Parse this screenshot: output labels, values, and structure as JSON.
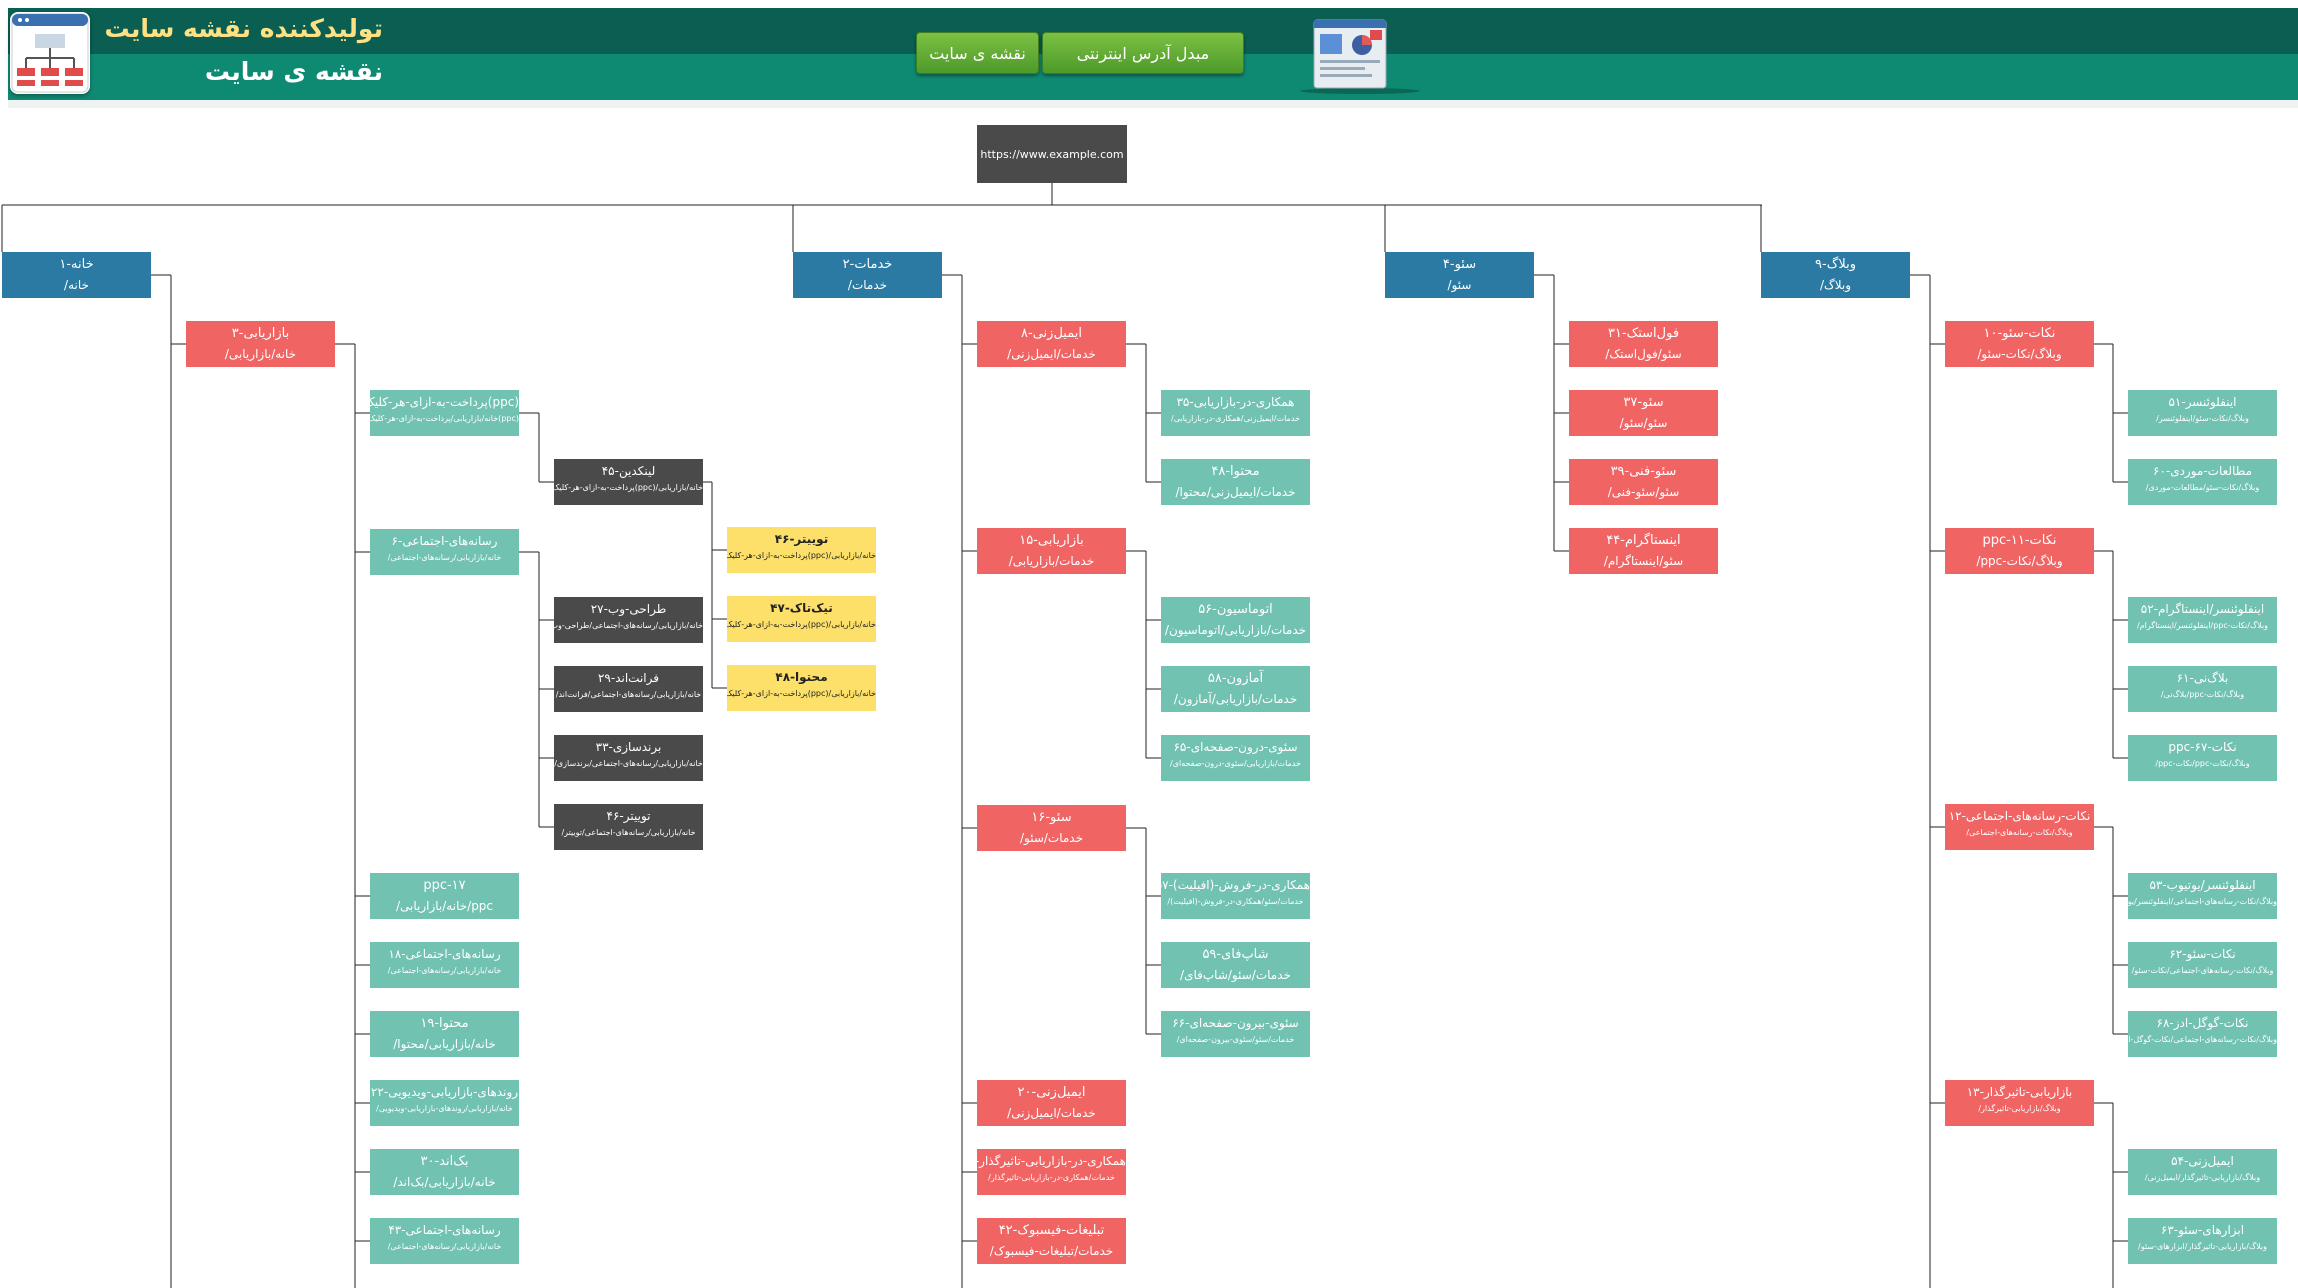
{
  "header": {
    "title": "تولیدکننده نقشه سایت",
    "subtitle": "نقشه ی سایت",
    "buttons": [
      {
        "label": "مبدل آدرس اینترنتی"
      },
      {
        "label": "نقشه ی سایت"
      }
    ]
  },
  "colors": {
    "level1": "#2a7aa3",
    "level2": "#f06464",
    "level3": "#72c2b1",
    "level4": "#4a4a4a",
    "level5": "#fde06a"
  },
  "root": {
    "url": "https://www.example.com"
  },
  "nodes": [
    {
      "id": "home",
      "color": "blue",
      "t1": "خانه-۱",
      "t2": "خانه/"
    },
    {
      "id": "services",
      "color": "blue",
      "t1": "خدمات-۲",
      "t2": "خدمات/"
    },
    {
      "id": "seo",
      "color": "blue",
      "t1": "سئو-۴",
      "t2": "سئو/"
    },
    {
      "id": "blog",
      "color": "blue",
      "t1": "وبلاگ-۹",
      "t2": "وبلاگ/"
    },
    {
      "id": "h-marketing",
      "color": "red",
      "t1": "بازاریابی-۳",
      "t2": "خانه/بازاریابی/"
    },
    {
      "id": "h-ppc5",
      "color": "teal",
      "sm": true,
      "t1": "(ppc)پرداخت-به-ازای-هر-کلیک-۵",
      "t2": "(ppc)خانه/بازاریابی/پرداخت-به-ازای-هر-کلیک/"
    },
    {
      "id": "h-social6",
      "color": "teal",
      "sm": true,
      "t1": "رسانه‌های-اجتماعی-۶",
      "t2": "خانه/بازاریابی/رسانه‌های-اجتماعی/"
    },
    {
      "id": "h-ppc17",
      "color": "teal",
      "t1": "ppc-۱۷",
      "t2": "ppc/خانه/بازاریابی/"
    },
    {
      "id": "h-social18",
      "color": "teal",
      "sm": true,
      "t1": "رسانه‌های-اجتماعی-۱۸",
      "t2": "خانه/بازاریابی/رسانه‌های-اجتماعی/"
    },
    {
      "id": "h-content19",
      "color": "teal",
      "t1": "محتوا-۱۹",
      "t2": "خانه/بازاریابی/محتوا/"
    },
    {
      "id": "h-video22",
      "color": "teal",
      "sm": true,
      "t1": "روندهای-بازاریابی-ویدیویی-۲۲",
      "t2": "خانه/بازاریابی/روندهای-بازاریابی-ویدیویی/"
    },
    {
      "id": "h-backend30",
      "color": "teal",
      "t1": "بک‌اند-۳۰",
      "t2": "خانه/بازاریابی/بک‌اند/"
    },
    {
      "id": "h-social43",
      "color": "teal",
      "sm": true,
      "t1": "رسانه‌های-اجتماعی-۴۳",
      "t2": "خانه/بازاریابی/رسانه‌های-اجتماعی/"
    },
    {
      "id": "h-linkedin45",
      "color": "dark",
      "sm": true,
      "t1": "لینکدین-۴۵",
      "t2": "خانه/بازاریابی/(ppc)پرداخت-به-ازای-هر-کلیک/"
    },
    {
      "id": "h-webdesign27",
      "color": "dark",
      "sm": true,
      "t1": "طراحی-وب-۲۷",
      "t2": "خانه/بازاریابی/رسانه‌های-اجتماعی/طراحی-وب/"
    },
    {
      "id": "h-frontend29",
      "color": "dark",
      "sm": true,
      "t1": "فرانت‌اند-۲۹",
      "t2": "خانه/بازاریابی/رسانه‌های-اجتماعی/فرانت‌اند/"
    },
    {
      "id": "h-branding33",
      "color": "dark",
      "sm": true,
      "t1": "برندسازی-۳۳",
      "t2": "خانه/بازاریابی/رسانه‌های-اجتماعی/برندسازی/"
    },
    {
      "id": "h-twitter46b",
      "color": "dark",
      "sm": true,
      "t1": "توییتر-۴۶",
      "t2": "خانه/بازاریابی/رسانه‌های-اجتماعی/توییتر/"
    },
    {
      "id": "h-twitter46",
      "color": "yellow",
      "sm": true,
      "t1": "توییتر-۴۶",
      "t2": "خانه/بازاریابی/(ppc)پرداخت-به-ازای-هر-کلیک/"
    },
    {
      "id": "h-tiktok47",
      "color": "yellow",
      "sm": true,
      "t1": "تیک‌تاک-۴۷",
      "t2": "خانه/بازاریابی/(ppc)پرداخت-به-ازای-هر-کلیک/تیک‌تاک/"
    },
    {
      "id": "h-content48",
      "color": "yellow",
      "sm": true,
      "t1": "محتوا-۴۸",
      "t2": "خانه/بازاریابی/(ppc)پرداخت-به-ازای-هر-کلیک/"
    },
    {
      "id": "s-email8",
      "color": "red",
      "t1": "ایمیل‌زنی-۸",
      "t2": "خدمات/ایمیل‌زنی/"
    },
    {
      "id": "s-marketing15",
      "color": "red",
      "t1": "بازاریابی-۱۵",
      "t2": "خدمات/بازاریابی/"
    },
    {
      "id": "s-seo16",
      "color": "red",
      "t1": "سئو-۱۶",
      "t2": "خدمات/سئو/"
    },
    {
      "id": "s-email20",
      "color": "red",
      "t1": "ایمیل‌زنی-۲۰",
      "t2": "خدمات/ایمیل‌زنی/"
    },
    {
      "id": "s-affiliate21",
      "color": "red",
      "sm": true,
      "t1": "همکاری-در-بازاریابی-تاثیرگذار-۲۱",
      "t2": "خدمات/همکاری-در-بازاریابی-تاثیرگذار/"
    },
    {
      "id": "s-fbads42",
      "color": "red",
      "t1": "تبلیغات-فیسبوک-۴۲",
      "t2": "خدمات/تبلیغات-فیسبوک/"
    },
    {
      "id": "s-affil35",
      "color": "teal",
      "sm": true,
      "t1": "همکاری-در-بازاریابی-۳۵",
      "t2": "خدمات/ایمیل‌زنی/همکاری-در-بازاریابی/"
    },
    {
      "id": "s-content48",
      "color": "teal",
      "t1": "محتوا-۴۸",
      "t2": "خدمات/ایمیل‌زنی/محتوا/"
    },
    {
      "id": "s-auto56",
      "color": "teal",
      "t1": "اتوماسیون-۵۶",
      "t2": "خدمات/بازاریابی/اتوماسیون/"
    },
    {
      "id": "s-amazon58",
      "color": "teal",
      "t1": "آمازون-۵۸",
      "t2": "خدمات/بازاریابی/آمازون/"
    },
    {
      "id": "s-onpage65",
      "color": "teal",
      "sm": true,
      "t1": "سئوی-درون-صفحه‌ای-۶۵",
      "t2": "خدمات/بازاریابی/سئوی-درون-صفحه‌ای/"
    },
    {
      "id": "s-affiliate57",
      "color": "teal",
      "sm": true,
      "t1": "همکاری-در-فروش-(افیلیت)-۵۷",
      "t2": "خدمات/سئو/همکاری-در-فروش-(افیلیت)/"
    },
    {
      "id": "s-shopify59",
      "color": "teal",
      "t1": "شاپ‌فای-۵۹",
      "t2": "خدمات/سئو/شاپ‌فای/"
    },
    {
      "id": "s-offpage66",
      "color": "teal",
      "sm": true,
      "t1": "سئوی-بیرون-صفحه‌ای-۶۶",
      "t2": "خدمات/سئو/سئوی-بیرون-صفحه‌ای/"
    },
    {
      "id": "o-fullstack31",
      "color": "red",
      "t1": "فول‌استک-۳۱",
      "t2": "سئو/فول‌استک/"
    },
    {
      "id": "o-seo37",
      "color": "red",
      "t1": "سئو-۳۷",
      "t2": "سئو/سئو/"
    },
    {
      "id": "o-tech39",
      "color": "red",
      "t1": "سئو-فنی-۳۹",
      "t2": "سئو/سئو-فنی/"
    },
    {
      "id": "o-insta44",
      "color": "red",
      "t1": "اینستاگرام-۴۴",
      "t2": "سئو/اینستاگرام/"
    },
    {
      "id": "b-tips10",
      "color": "red",
      "t1": "نکات-سئو-۱۰",
      "t2": "وبلاگ/نکات-سئو/"
    },
    {
      "id": "b-ppc11",
      "color": "red",
      "t1": "نکات-ppc-۱۱",
      "t2": "وبلاگ/نکات-ppc/"
    },
    {
      "id": "b-social12",
      "color": "red",
      "sm": true,
      "t1": "نکات-رسانه‌های-اجتماعی-۱۲",
      "t2": "وبلاگ/نکات-رسانه‌های-اجتماعی/"
    },
    {
      "id": "b-influencer13",
      "color": "red",
      "sm": true,
      "t1": "بازاریابی-تاثیرگذار-۱۳",
      "t2": "وبلاگ/بازاریابی-تاثیرگذار/"
    },
    {
      "id": "b-inf51",
      "color": "teal",
      "sm": true,
      "t1": "اینفلوئنسر-۵۱",
      "t2": "وبلاگ/نکات-سئو/اینفلوئنسر/"
    },
    {
      "id": "b-case60",
      "color": "teal",
      "sm": true,
      "t1": "مطالعات-موردی-۶۰",
      "t2": "وبلاگ/نکات-سئو/مطالعات-موردی/"
    },
    {
      "id": "b-instainf52",
      "color": "teal",
      "sm": true,
      "t1": "اینفلوئنسر/اینستاگرام-۵۲",
      "t2": "وبلاگ/نکات-ppc/اینفلوئنسر/اینستاگرام/"
    },
    {
      "id": "b-blog61",
      "color": "teal",
      "sm": true,
      "t1": "بلاگ‌نی-۶۱",
      "t2": "وبلاگ/نکات-ppc/بلاگ‌نی/"
    },
    {
      "id": "b-ppc67",
      "color": "teal",
      "sm": true,
      "t1": "نکات-ppc-۶۷",
      "t2": "وبلاگ/نکات-ppc/نکات-ppc/"
    },
    {
      "id": "b-yt53",
      "color": "teal",
      "sm": true,
      "t1": "اینفلوئنسر/یوتیوب-۵۳",
      "t2": "وبلاگ/نکات-رسانه‌های-اجتماعی/اینفلوئنسر/یوتیوب/"
    },
    {
      "id": "b-seo62",
      "color": "teal",
      "sm": true,
      "t1": "نکات-سئو-۶۲",
      "t2": "وبلاگ/نکات-رسانه‌های-اجتماعی/نکات-سئو/"
    },
    {
      "id": "b-gads68",
      "color": "teal",
      "sm": true,
      "t1": "نکات-گوگل-ادز-۶۸",
      "t2": "وبلاگ/نکات-رسانه‌های-اجتماعی/نکات-گوگل-ادز/"
    },
    {
      "id": "b-email54",
      "color": "teal",
      "sm": true,
      "t1": "ایمیل‌زنی-۵۴",
      "t2": "وبلاگ/بازاریابی-تاثیرگذار/ایمیل‌زنی/"
    },
    {
      "id": "b-tools63",
      "color": "teal",
      "sm": true,
      "t1": "ابزارهای-سئو-۶۳",
      "t2": "وبلاگ/بازاریابی-تاثیرگذار/ابزارهای-سئو/"
    }
  ]
}
